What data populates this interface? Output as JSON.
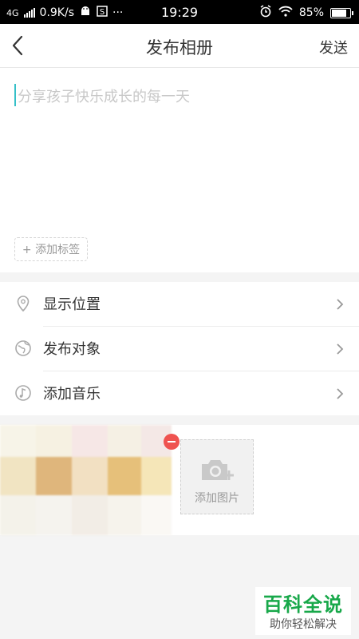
{
  "status_bar": {
    "network": "4G",
    "speed": "0.9K/s",
    "more": "···",
    "time": "19:29",
    "battery": "85%"
  },
  "header": {
    "title": "发布相册",
    "send_label": "发送"
  },
  "editor": {
    "placeholder": "分享孩子快乐成长的每一天",
    "add_tag_label": "+ 添加标签"
  },
  "options": [
    {
      "label": "显示位置",
      "icon": "location-pin-icon"
    },
    {
      "label": "发布对象",
      "icon": "globe-icon"
    },
    {
      "label": "添加音乐",
      "icon": "music-note-icon"
    }
  ],
  "photos": {
    "add_photo_label": "添加图片"
  },
  "watermark": {
    "title": "百科全说",
    "subtitle": "助你轻松解决"
  },
  "colors": {
    "accent_cursor": "#35c0c8",
    "remove_badge": "#ef5350",
    "watermark_green": "#18a84a"
  }
}
